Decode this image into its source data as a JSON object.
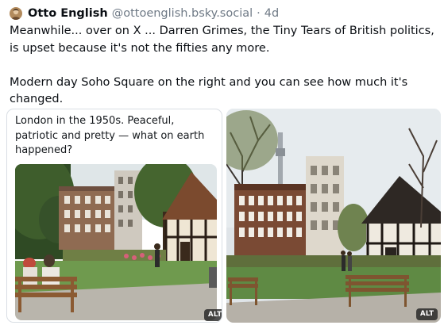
{
  "post": {
    "author_name": "Otto English",
    "handle": "@ottoenglish.bsky.social",
    "separator": "·",
    "timestamp": "4d",
    "avatar_icon": "profile-avatar-icon",
    "paragraphs": [
      "Meanwhile... over on X ... Darren Grimes, the Tiny Tears of British politics, is upset because it's not the fifties any more.",
      "Modern day Soho Square on the right and you can see how much it's changed."
    ]
  },
  "images": {
    "left": {
      "caption": "London in the 1950s. Peaceful, patriotic and pretty — what on earth happened?",
      "alt_badge": "ALT"
    },
    "right": {
      "alt_badge": "ALT"
    }
  },
  "colors": {
    "text": "#0b0f14",
    "muted": "#6f7a86",
    "card_border": "#d9dee4"
  }
}
